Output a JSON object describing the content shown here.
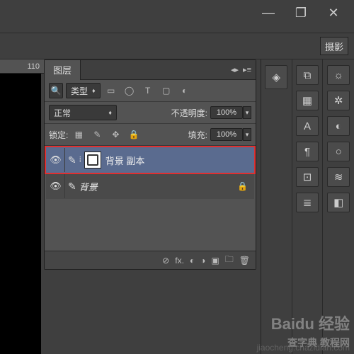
{
  "titlebar": {
    "minimize": "—",
    "maximize": "❐",
    "close": "✕"
  },
  "toolbar": {
    "preset_label": "摄影"
  },
  "ruler": {
    "mark": "110"
  },
  "panel": {
    "title": "图层",
    "menu_glyph": "▸≡",
    "filter": {
      "search_icon": "🔍",
      "type_label": "类型",
      "icons": [
        "▭",
        "◯",
        "T",
        "▢",
        "◐"
      ]
    },
    "blend": {
      "mode": "正常",
      "opacity_label": "不透明度:",
      "opacity_value": "100%"
    },
    "lock": {
      "label": "锁定:",
      "icons": [
        "▦",
        "✎",
        "✥",
        "🔒"
      ],
      "fill_label": "填充:",
      "fill_value": "100%"
    },
    "layers": [
      {
        "name": "背景 副本",
        "visible": true,
        "selected": true,
        "highlighted": true,
        "has_mask": true,
        "italic": false,
        "locked": false
      },
      {
        "name": "背景",
        "visible": true,
        "selected": false,
        "highlighted": false,
        "has_mask": false,
        "italic": true,
        "locked": true
      }
    ],
    "footer": {
      "icons": [
        "⊘",
        "fx.",
        "◐",
        "◑",
        "▣",
        "🗀",
        "⊞",
        "🗑"
      ]
    }
  },
  "dock": {
    "col1": [
      {
        "n": "layers-stack-icon",
        "g": "◈"
      }
    ],
    "col2": [
      {
        "n": "history-icon",
        "g": "⧉"
      },
      {
        "n": "swatches-icon",
        "g": "▦"
      },
      {
        "n": "text-icon",
        "g": "A"
      },
      {
        "n": "paragraph-icon",
        "g": "¶"
      },
      {
        "n": "info-icon",
        "g": "⊡"
      },
      {
        "n": "list-icon",
        "g": "≣"
      }
    ],
    "col3": [
      {
        "n": "sun-icon",
        "g": "☼"
      },
      {
        "n": "gear-icon",
        "g": "✲"
      },
      {
        "n": "adjust-icon",
        "g": "◐"
      },
      {
        "n": "circle-icon",
        "g": "○"
      },
      {
        "n": "sliders-icon",
        "g": "≋"
      },
      {
        "n": "square-icon",
        "g": "◧"
      }
    ]
  },
  "watermark": {
    "main": "Baidu 经验",
    "sub": "查字典 教程网",
    "url": "jiaocheng.chazidian.com"
  }
}
